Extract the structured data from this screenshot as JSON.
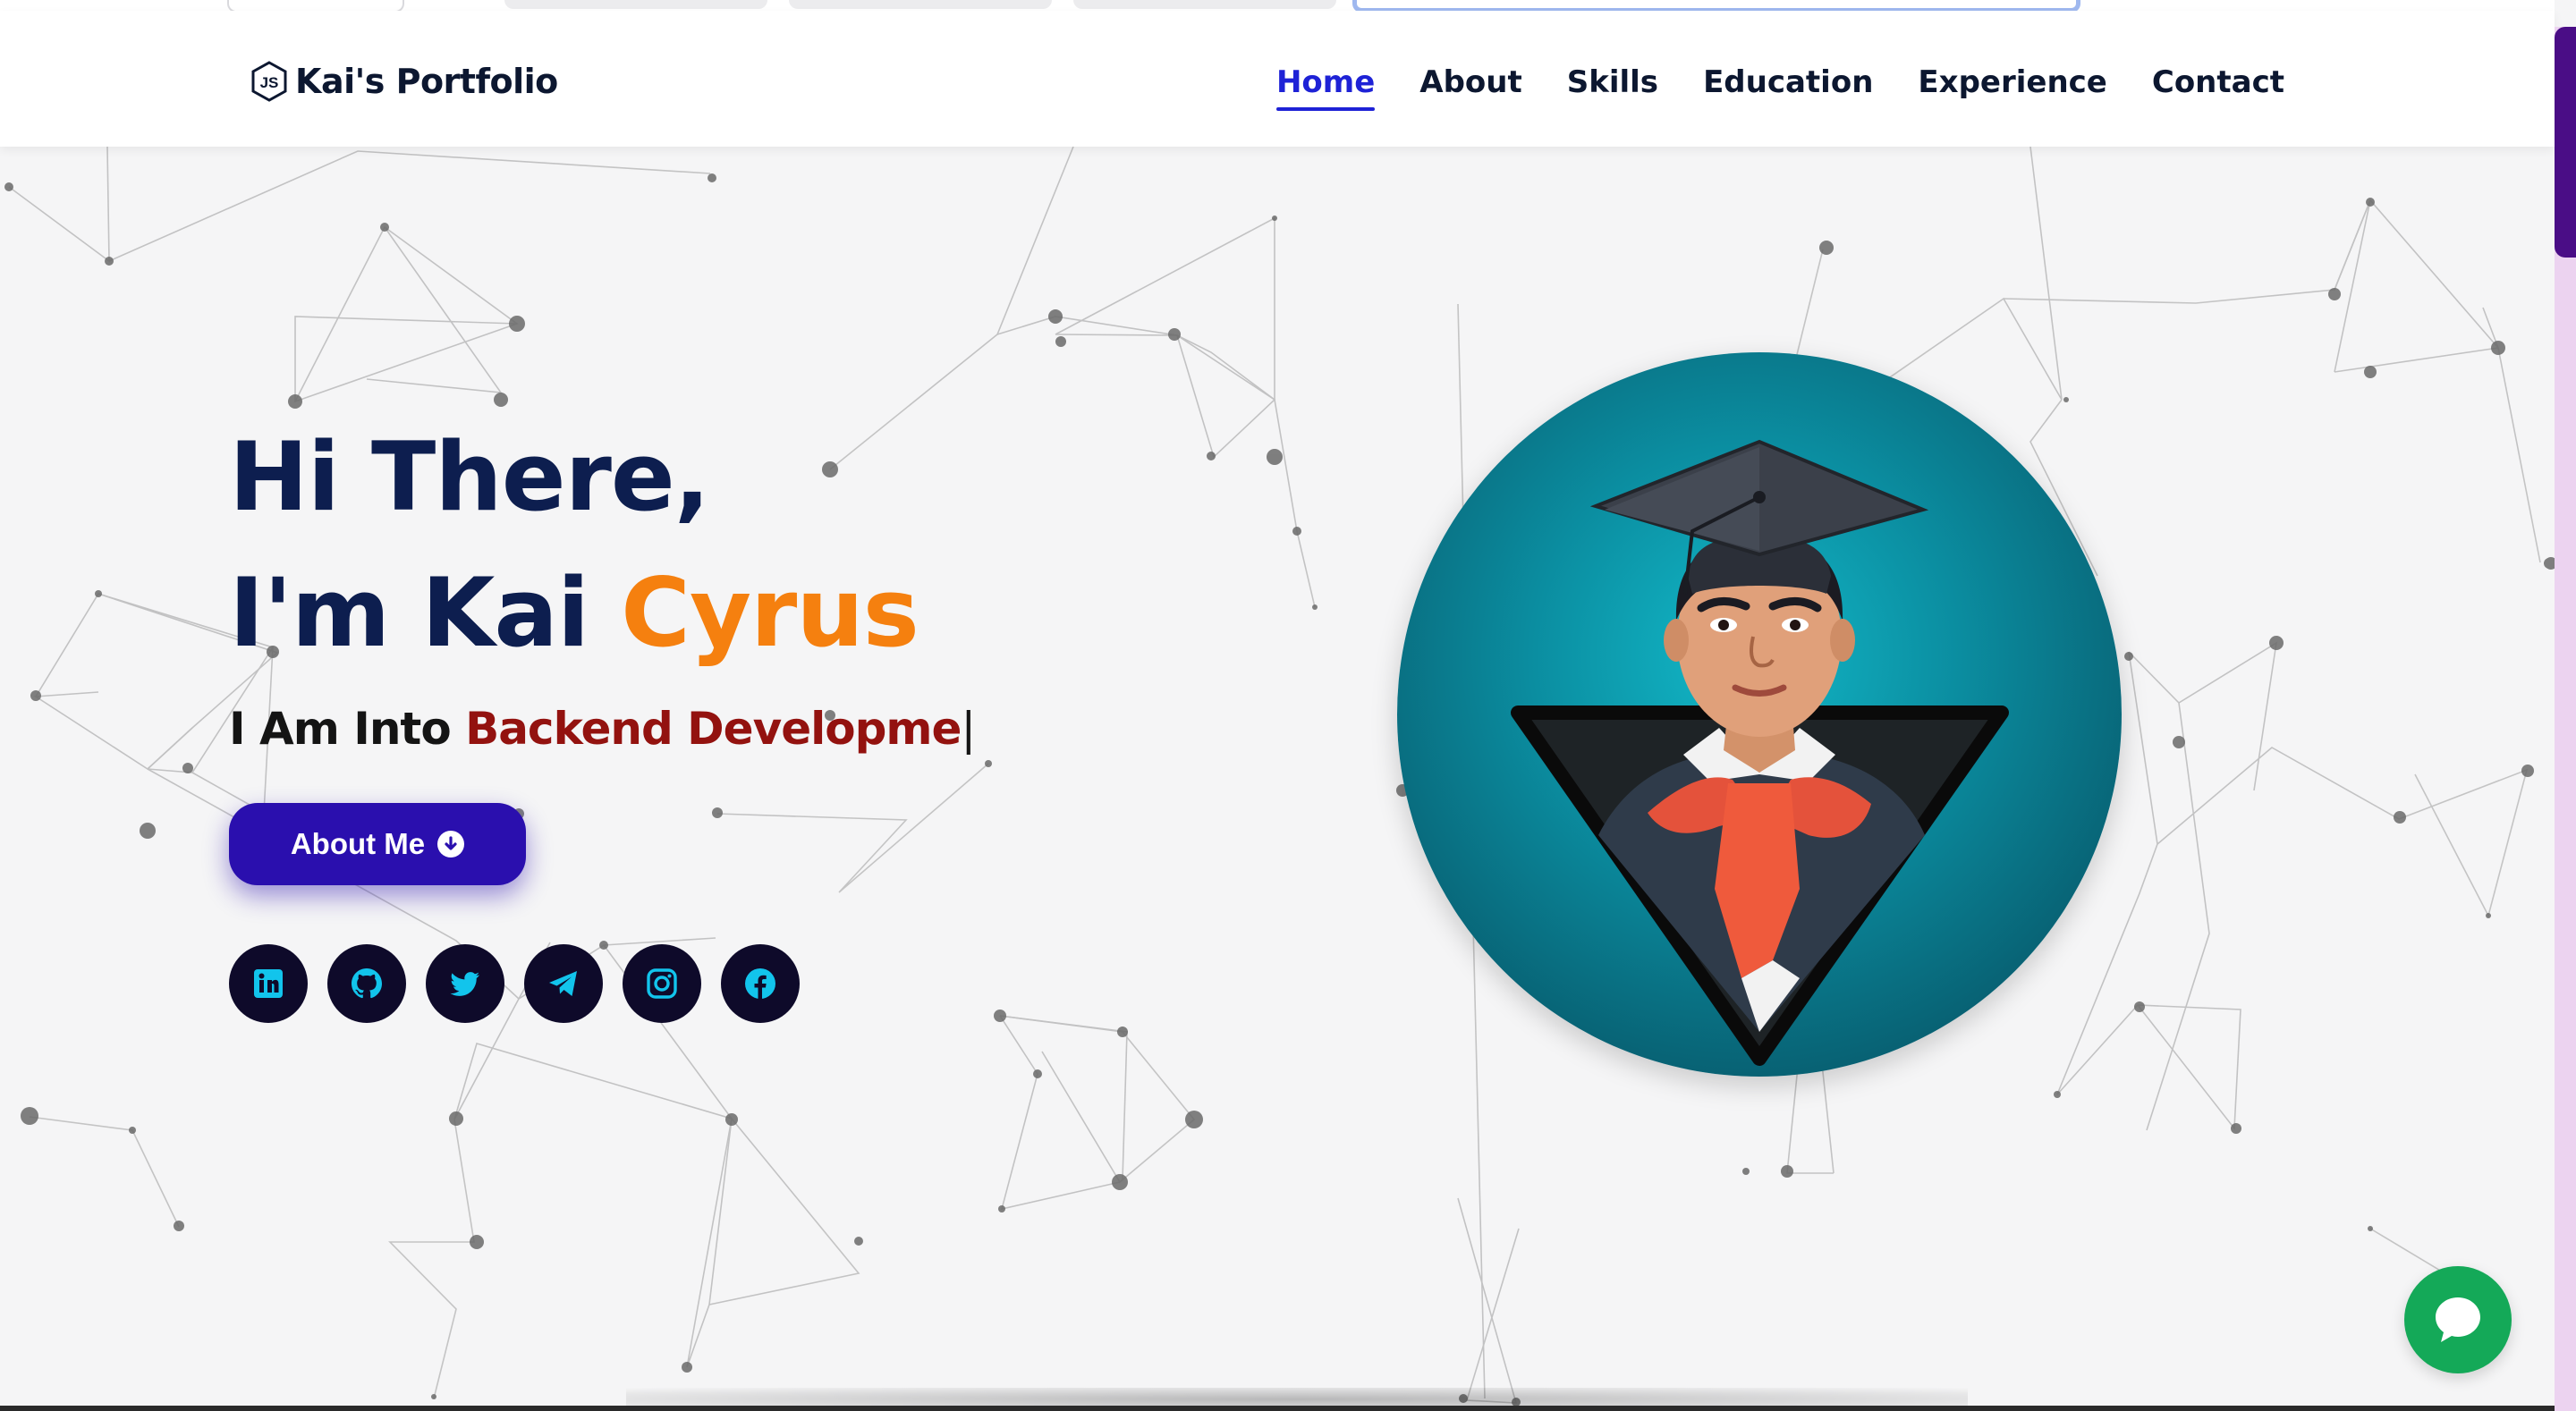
{
  "header": {
    "logo_text": "Kai's Portfolio",
    "nav": [
      {
        "label": "Home",
        "active": true
      },
      {
        "label": "About"
      },
      {
        "label": "Skills"
      },
      {
        "label": "Education"
      },
      {
        "label": "Experience"
      },
      {
        "label": "Contact"
      }
    ]
  },
  "hero": {
    "greeting": "Hi There,",
    "intro_prefix": "I'm Kai ",
    "intro_name": "Cyrus",
    "subtitle_prefix": "I Am Into ",
    "subtitle_typed": "Backend Developme",
    "caret": "|",
    "about_button": "About Me"
  },
  "socials": [
    {
      "name": "linkedin-icon"
    },
    {
      "name": "github-icon"
    },
    {
      "name": "twitter-icon"
    },
    {
      "name": "telegram-icon"
    },
    {
      "name": "instagram-icon"
    },
    {
      "name": "facebook-icon"
    }
  ],
  "colors": {
    "nav_active": "#1e22d6",
    "heading": "#0d1e4f",
    "accent_orange": "#f5800f",
    "typed_red": "#93120f",
    "button": "#2a0fae",
    "social_bg": "#0e0a2a",
    "social_icon": "#12c4ec",
    "chat": "#14a958"
  }
}
